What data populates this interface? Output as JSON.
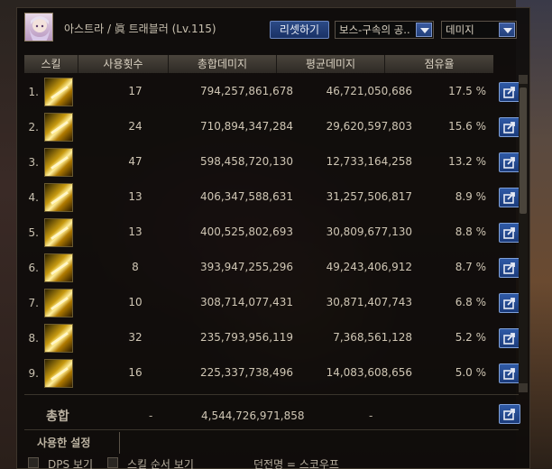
{
  "header": {
    "title": "아스트라 / 眞 트래블러 (Lv.115)",
    "reset_label": "리셋하기",
    "dungeon_select": "보스-구속의 공..",
    "metric_select": "데미지"
  },
  "table": {
    "columns": [
      "스킬",
      "사용횟수",
      "총합데미지",
      "평균데미지",
      "점유율"
    ],
    "rows": [
      {
        "rank": "1.",
        "count": "17",
        "total": "794,257,861,678",
        "avg": "46,721,050,686",
        "share": "17.5 %"
      },
      {
        "rank": "2.",
        "count": "24",
        "total": "710,894,347,284",
        "avg": "29,620,597,803",
        "share": "15.6 %"
      },
      {
        "rank": "3.",
        "count": "47",
        "total": "598,458,720,130",
        "avg": "12,733,164,258",
        "share": "13.2 %"
      },
      {
        "rank": "4.",
        "count": "13",
        "total": "406,347,588,631",
        "avg": "31,257,506,817",
        "share": "8.9 %"
      },
      {
        "rank": "5.",
        "count": "13",
        "total": "400,525,802,693",
        "avg": "30,809,677,130",
        "share": "8.8 %"
      },
      {
        "rank": "6.",
        "count": "8",
        "total": "393,947,255,296",
        "avg": "49,243,406,912",
        "share": "8.7 %"
      },
      {
        "rank": "7.",
        "count": "10",
        "total": "308,714,077,431",
        "avg": "30,871,407,743",
        "share": "6.8 %"
      },
      {
        "rank": "8.",
        "count": "32",
        "total": "235,793,956,119",
        "avg": "7,368,561,128",
        "share": "5.2 %"
      },
      {
        "rank": "9.",
        "count": "16",
        "total": "225,337,738,496",
        "avg": "14,083,608,656",
        "share": "5.0 %"
      }
    ]
  },
  "totals": {
    "label": "총합",
    "count": "-",
    "total": "4,544,726,971,858",
    "avg": "-"
  },
  "settings_tab": "사용한 설정",
  "bottom": {
    "dps_label": "DPS 보기",
    "order_label": "스킬 순서 보기",
    "dungeon_label": "던전명 = 스코우프"
  }
}
